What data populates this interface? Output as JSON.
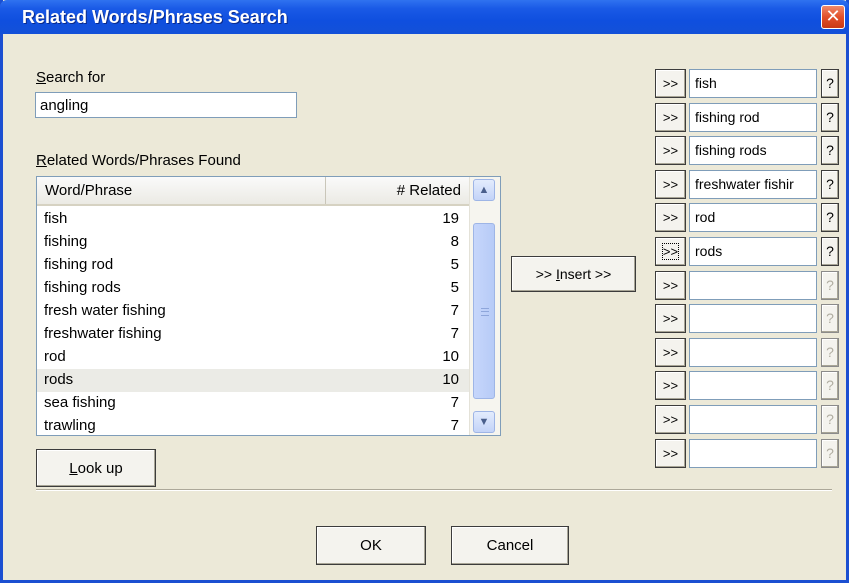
{
  "window": {
    "title": "Related Words/Phrases Search",
    "close_glyph": "✕"
  },
  "search": {
    "label_accel": "S",
    "label_rest": "earch for",
    "value": "angling"
  },
  "results": {
    "label_accel": "R",
    "label_rest": "elated Words/Phrases Found",
    "col_word": "Word/Phrase",
    "col_related": "# Related",
    "rows": [
      {
        "word": "fish",
        "count": "19"
      },
      {
        "word": "fishing",
        "count": "8"
      },
      {
        "word": "fishing rod",
        "count": "5"
      },
      {
        "word": "fishing rods",
        "count": "5"
      },
      {
        "word": "fresh water fishing",
        "count": "7"
      },
      {
        "word": "freshwater fishing",
        "count": "7"
      },
      {
        "word": "rod",
        "count": "10"
      },
      {
        "word": "rods",
        "count": "10"
      },
      {
        "word": "sea fishing",
        "count": "7"
      },
      {
        "word": "trawling",
        "count": "7"
      }
    ],
    "selected_index": 7
  },
  "buttons": {
    "lookup_accel": "L",
    "lookup_rest": "ook up",
    "insert_prefix": ">> ",
    "insert_accel": "I",
    "insert_suffix": "nsert >>",
    "ok": "OK",
    "cancel": "Cancel"
  },
  "slots": {
    "arrow_label": ">>",
    "help_label": "?",
    "values": [
      "fish",
      "fishing rod",
      "fishing rods",
      "freshwater fishir",
      "rod",
      "rods",
      "",
      "",
      "",
      "",
      "",
      ""
    ],
    "focused_index": 5
  },
  "colors": {
    "titlebar": "#0f4fdf",
    "dialog_bg": "#ece9d8",
    "close": "#e2502a"
  }
}
